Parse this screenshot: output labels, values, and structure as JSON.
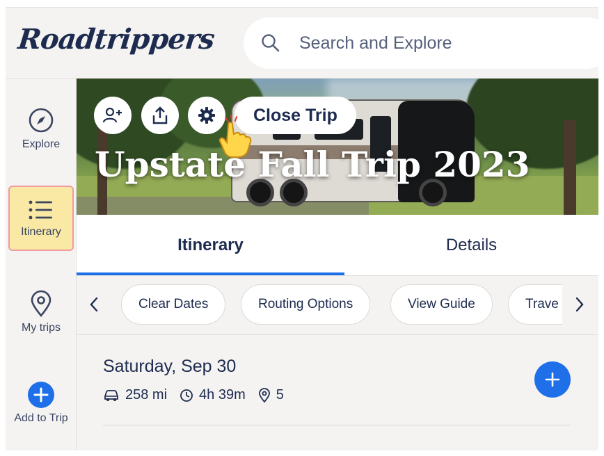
{
  "app": {
    "logo": "Roadtrippers"
  },
  "search": {
    "placeholder": "Search and Explore",
    "icon": "search-icon"
  },
  "sidebar": {
    "items": [
      {
        "label": "Explore",
        "icon": "compass-icon"
      },
      {
        "label": "Itinerary",
        "icon": "list-icon",
        "active": true
      },
      {
        "label": "My trips",
        "icon": "location-pin-icon"
      },
      {
        "label": "Add to Trip",
        "icon": "plus-icon"
      }
    ]
  },
  "hero": {
    "title": "Upstate Fall Trip 2023",
    "buttons": [
      {
        "icon": "add-person-icon"
      },
      {
        "icon": "share-icon"
      },
      {
        "icon": "gear-icon"
      }
    ],
    "close_label": "Close Trip"
  },
  "tabs": [
    {
      "label": "Itinerary",
      "active": true
    },
    {
      "label": "Details"
    }
  ],
  "chips": [
    "Clear Dates",
    "Routing Options",
    "View Guide",
    "Trave"
  ],
  "day": {
    "title": "Saturday, Sep 30",
    "distance": "258 mi",
    "duration": "4h 39m",
    "stops": "5"
  },
  "colors": {
    "accent": "#1e6fe8",
    "text": "#1d2b4f",
    "active_nav_bg": "#f9e9a4",
    "active_nav_border": "#ef9ba0",
    "background": "#f4f3f2"
  }
}
